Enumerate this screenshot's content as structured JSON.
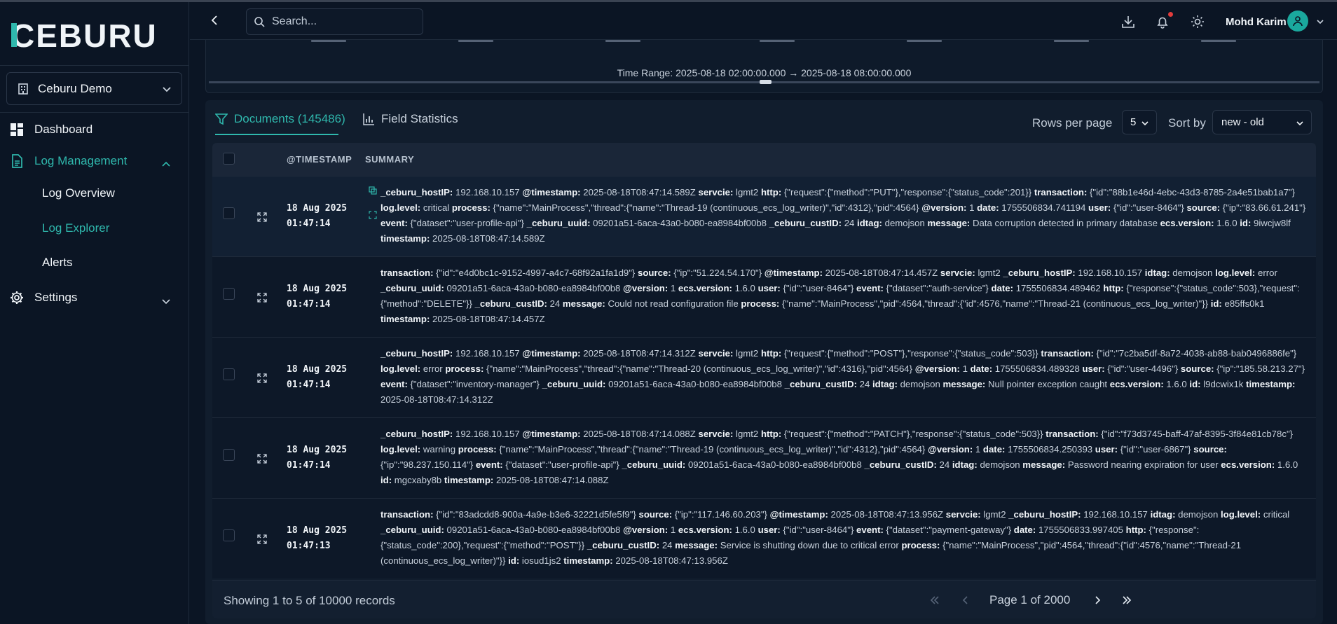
{
  "app": {
    "logo_text": "CEBURU",
    "organization": "Ceburu Demo"
  },
  "sidebar": {
    "items": [
      {
        "label": "Dashboard",
        "icon": "dashboard-icon"
      },
      {
        "label": "Log Management",
        "icon": "document-icon",
        "expanded": true
      },
      {
        "label": "Settings",
        "icon": "gear-icon"
      }
    ],
    "log_management_children": [
      {
        "label": "Log Overview"
      },
      {
        "label": "Log Explorer",
        "active": true
      },
      {
        "label": "Alerts"
      }
    ]
  },
  "header": {
    "search_placeholder": "Search...",
    "user_name": "Mohd Karim"
  },
  "chart_remnant": {
    "time_range": "Time Range: 2025-08-18 02:00:00.000 → 2025-08-18 08:00:00.000"
  },
  "tabs": {
    "documents": "Documents (145486)",
    "field_statistics": "Field Statistics"
  },
  "controls": {
    "rows_per_page_label": "Rows per page",
    "rows_per_page_value": "5",
    "sort_by_label": "Sort by",
    "sort_by_value": "new - old"
  },
  "table": {
    "columns": [
      "@TIMESTAMP",
      "SUMMARY"
    ],
    "rows": [
      {
        "date": "18 Aug 2025",
        "time": "01:47:14",
        "summary": [
          [
            "_ceburu_hostIP:",
            "192.168.10.157"
          ],
          [
            "@timestamp:",
            "2025-08-18T08:47:14.589Z"
          ],
          [
            "servcie:",
            "lgmt2"
          ],
          [
            "http:",
            "{\"request\":{\"method\":\"PUT\"},\"response\":{\"status_code\":201}}"
          ],
          [
            "transaction:",
            "{\"id\":\"88b1e46d-4ebc-43d3-8785-2a4e51bab1a7\"}"
          ],
          [
            "log.level:",
            "critical"
          ],
          [
            "process:",
            "{\"name\":\"MainProcess\",\"thread\":{\"name\":\"Thread-19 (continuous_ecs_log_writer)\",\"id\":4312},\"pid\":4564}"
          ],
          [
            "@version:",
            "1"
          ],
          [
            "date:",
            "1755506834.741194"
          ],
          [
            "user:",
            "{\"id\":\"user-8464\"}"
          ],
          [
            "source:",
            "{\"ip\":\"83.66.61.241\"}"
          ],
          [
            "event:",
            "{\"dataset\":\"user-profile-api\"}"
          ],
          [
            "_ceburu_uuid:",
            "09201a51-6aca-43a0-b080-ea8984bf00b8"
          ],
          [
            "_ceburu_custID:",
            "24"
          ],
          [
            "idtag:",
            "demojson"
          ],
          [
            "message:",
            "Data corruption detected in primary database"
          ],
          [
            "ecs.version:",
            "1.6.0"
          ],
          [
            "id:",
            "9iwcjw8lf"
          ],
          [
            "timestamp:",
            "2025-08-18T08:47:14.589Z"
          ]
        ]
      },
      {
        "date": "18 Aug 2025",
        "time": "01:47:14",
        "summary": [
          [
            "transaction:",
            "{\"id\":\"e4d0bc1c-9152-4997-a4c7-68f92a1fa1d9\"}"
          ],
          [
            "source:",
            "{\"ip\":\"51.224.54.170\"}"
          ],
          [
            "@timestamp:",
            "2025-08-18T08:47:14.457Z"
          ],
          [
            "servcie:",
            "lgmt2"
          ],
          [
            "_ceburu_hostIP:",
            "192.168.10.157"
          ],
          [
            "idtag:",
            "demojson"
          ],
          [
            "log.level:",
            "error"
          ],
          [
            "_ceburu_uuid:",
            "09201a51-6aca-43a0-b080-ea8984bf00b8"
          ],
          [
            "@version:",
            "1"
          ],
          [
            "ecs.version:",
            "1.6.0"
          ],
          [
            "user:",
            "{\"id\":\"user-8464\"}"
          ],
          [
            "event:",
            "{\"dataset\":\"auth-service\"}"
          ],
          [
            "date:",
            "1755506834.489462"
          ],
          [
            "http:",
            "{\"response\":{\"status_code\":503},\"request\":{\"method\":\"DELETE\"}}"
          ],
          [
            "_ceburu_custID:",
            "24"
          ],
          [
            "message:",
            "Could not read configuration file"
          ],
          [
            "process:",
            "{\"name\":\"MainProcess\",\"pid\":4564,\"thread\":{\"id\":4576,\"name\":\"Thread-21 (continuous_ecs_log_writer)\"}}"
          ],
          [
            "id:",
            "e85ffs0k1"
          ],
          [
            "timestamp:",
            "2025-08-18T08:47:14.457Z"
          ]
        ]
      },
      {
        "date": "18 Aug 2025",
        "time": "01:47:14",
        "summary": [
          [
            "_ceburu_hostIP:",
            "192.168.10.157"
          ],
          [
            "@timestamp:",
            "2025-08-18T08:47:14.312Z"
          ],
          [
            "servcie:",
            "lgmt2"
          ],
          [
            "http:",
            "{\"request\":{\"method\":\"POST\"},\"response\":{\"status_code\":503}}"
          ],
          [
            "transaction:",
            "{\"id\":\"7c2ba5df-8a72-4038-ab88-bab0496886fe\"}"
          ],
          [
            "log.level:",
            "error"
          ],
          [
            "process:",
            "{\"name\":\"MainProcess\",\"thread\":{\"name\":\"Thread-20 (continuous_ecs_log_writer)\",\"id\":4316},\"pid\":4564}"
          ],
          [
            "@version:",
            "1"
          ],
          [
            "date:",
            "1755506834.489328"
          ],
          [
            "user:",
            "{\"id\":\"user-4496\"}"
          ],
          [
            "source:",
            "{\"ip\":\"185.58.213.27\"}"
          ],
          [
            "event:",
            "{\"dataset\":\"inventory-manager\"}"
          ],
          [
            "_ceburu_uuid:",
            "09201a51-6aca-43a0-b080-ea8984bf00b8"
          ],
          [
            "_ceburu_custID:",
            "24"
          ],
          [
            "idtag:",
            "demojson"
          ],
          [
            "message:",
            "Null pointer exception caught"
          ],
          [
            "ecs.version:",
            "1.6.0"
          ],
          [
            "id:",
            "l9dcwix1k"
          ],
          [
            "timestamp:",
            "2025-08-18T08:47:14.312Z"
          ]
        ]
      },
      {
        "date": "18 Aug 2025",
        "time": "01:47:14",
        "summary": [
          [
            "_ceburu_hostIP:",
            "192.168.10.157"
          ],
          [
            "@timestamp:",
            "2025-08-18T08:47:14.088Z"
          ],
          [
            "servcie:",
            "lgmt2"
          ],
          [
            "http:",
            "{\"request\":{\"method\":\"PATCH\"},\"response\":{\"status_code\":503}}"
          ],
          [
            "transaction:",
            "{\"id\":\"f73d3745-baff-47af-8395-3f84e81cb78c\"}"
          ],
          [
            "log.level:",
            "warning"
          ],
          [
            "process:",
            "{\"name\":\"MainProcess\",\"thread\":{\"name\":\"Thread-19 (continuous_ecs_log_writer)\",\"id\":4312},\"pid\":4564}"
          ],
          [
            "@version:",
            "1"
          ],
          [
            "date:",
            "1755506834.250393"
          ],
          [
            "user:",
            "{\"id\":\"user-6867\"}"
          ],
          [
            "source:",
            "{\"ip\":\"98.237.150.114\"}"
          ],
          [
            "event:",
            "{\"dataset\":\"user-profile-api\"}"
          ],
          [
            "_ceburu_uuid:",
            "09201a51-6aca-43a0-b080-ea8984bf00b8"
          ],
          [
            "_ceburu_custID:",
            "24"
          ],
          [
            "idtag:",
            "demojson"
          ],
          [
            "message:",
            "Password nearing expiration for user"
          ],
          [
            "ecs.version:",
            "1.6.0"
          ],
          [
            "id:",
            "mgcxaby8b"
          ],
          [
            "timestamp:",
            "2025-08-18T08:47:14.088Z"
          ]
        ]
      },
      {
        "date": "18 Aug 2025",
        "time": "01:47:13",
        "summary": [
          [
            "transaction:",
            "{\"id\":\"83adcdd8-900a-4a9e-b3e6-32221d5fe5f9\"}"
          ],
          [
            "source:",
            "{\"ip\":\"117.146.60.203\"}"
          ],
          [
            "@timestamp:",
            "2025-08-18T08:47:13.956Z"
          ],
          [
            "servcie:",
            "lgmt2"
          ],
          [
            "_ceburu_hostIP:",
            "192.168.10.157"
          ],
          [
            "idtag:",
            "demojson"
          ],
          [
            "log.level:",
            "critical"
          ],
          [
            "_ceburu_uuid:",
            "09201a51-6aca-43a0-b080-ea8984bf00b8"
          ],
          [
            "@version:",
            "1"
          ],
          [
            "ecs.version:",
            "1.6.0"
          ],
          [
            "user:",
            "{\"id\":\"user-8464\"}"
          ],
          [
            "event:",
            "{\"dataset\":\"payment-gateway\"}"
          ],
          [
            "date:",
            "1755506833.997405"
          ],
          [
            "http:",
            "{\"response\":{\"status_code\":200},\"request\":{\"method\":\"POST\"}}"
          ],
          [
            "_ceburu_custID:",
            "24"
          ],
          [
            "message:",
            "Service is shutting down due to critical error"
          ],
          [
            "process:",
            "{\"name\":\"MainProcess\",\"pid\":4564,\"thread\":{\"id\":4576,\"name\":\"Thread-21 (continuous_ecs_log_writer)\"}}"
          ],
          [
            "id:",
            "iosud1js2"
          ],
          [
            "timestamp:",
            "2025-08-18T08:47:13.956Z"
          ]
        ]
      }
    ]
  },
  "footer": {
    "showing": "Showing 1 to 5 of 10000 records",
    "page_label": "Page 1 of 2000"
  },
  "colors": {
    "accent": "#2fb8ad",
    "background": "#0b1524",
    "panel": "#111d2d",
    "notification_dot": "#e23c3c"
  }
}
